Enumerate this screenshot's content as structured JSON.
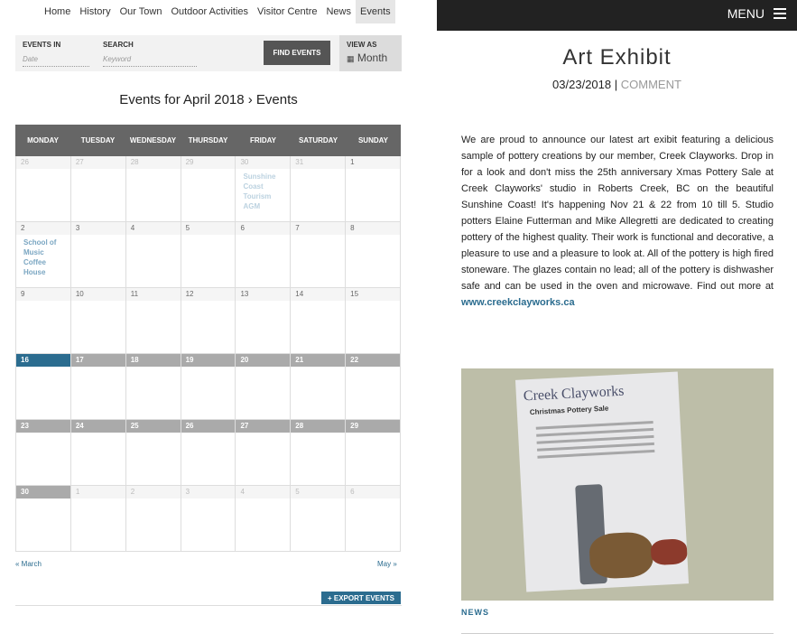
{
  "nav": {
    "items": [
      "Home",
      "History",
      "Our Town",
      "Outdoor Activities",
      "Visitor Centre",
      "News",
      "Events"
    ],
    "active": "Events"
  },
  "search_bar": {
    "events_in_label": "EVENTS IN",
    "date_placeholder": "Date",
    "search_label": "SEARCH",
    "keyword_placeholder": "Keyword",
    "find_button": "FIND EVENTS",
    "view_as_label": "VIEW AS",
    "view_value": "Month"
  },
  "calendar": {
    "title": "Events for April 2018 › Events",
    "days": [
      "MONDAY",
      "TUESDAY",
      "WEDNESDAY",
      "THURSDAY",
      "FRIDAY",
      "SATURDAY",
      "SUNDAY"
    ],
    "weeks": [
      [
        {
          "d": "26",
          "t": "other"
        },
        {
          "d": "27",
          "t": "other"
        },
        {
          "d": "28",
          "t": "other"
        },
        {
          "d": "29",
          "t": "other"
        },
        {
          "d": "30",
          "t": "other",
          "ev": "Sunshine Coast Tourism AGM"
        },
        {
          "d": "31",
          "t": "other"
        },
        {
          "d": "1",
          "t": "past"
        }
      ],
      [
        {
          "d": "2",
          "t": "past",
          "ev": "School of Music Coffee House"
        },
        {
          "d": "3",
          "t": "past"
        },
        {
          "d": "4",
          "t": "past"
        },
        {
          "d": "5",
          "t": "past"
        },
        {
          "d": "6",
          "t": "past"
        },
        {
          "d": "7",
          "t": "past"
        },
        {
          "d": "8",
          "t": "past"
        }
      ],
      [
        {
          "d": "9",
          "t": "past"
        },
        {
          "d": "10",
          "t": "past"
        },
        {
          "d": "11",
          "t": "past"
        },
        {
          "d": "12",
          "t": "past"
        },
        {
          "d": "13",
          "t": "past"
        },
        {
          "d": "14",
          "t": "past"
        },
        {
          "d": "15",
          "t": "past"
        }
      ],
      [
        {
          "d": "16",
          "t": "today"
        },
        {
          "d": "17",
          "t": "future"
        },
        {
          "d": "18",
          "t": "future"
        },
        {
          "d": "19",
          "t": "future"
        },
        {
          "d": "20",
          "t": "future"
        },
        {
          "d": "21",
          "t": "future"
        },
        {
          "d": "22",
          "t": "future"
        }
      ],
      [
        {
          "d": "23",
          "t": "future"
        },
        {
          "d": "24",
          "t": "future"
        },
        {
          "d": "25",
          "t": "future"
        },
        {
          "d": "26",
          "t": "future"
        },
        {
          "d": "27",
          "t": "future"
        },
        {
          "d": "28",
          "t": "future"
        },
        {
          "d": "29",
          "t": "future"
        }
      ],
      [
        {
          "d": "30",
          "t": "future"
        },
        {
          "d": "1",
          "t": "other"
        },
        {
          "d": "2",
          "t": "other"
        },
        {
          "d": "3",
          "t": "other"
        },
        {
          "d": "4",
          "t": "other"
        },
        {
          "d": "5",
          "t": "other"
        },
        {
          "d": "6",
          "t": "other"
        }
      ]
    ],
    "prev": "« March",
    "next": "May »",
    "export": "+ EXPORT EVENTS"
  },
  "header": {
    "menu_label": "MENU"
  },
  "article": {
    "title": "Art Exhibit",
    "date": "03/23/2018",
    "separator": "|",
    "comment": "COMMENT",
    "body": "We are proud to announce our latest art exibit featuring a delicious sample of pottery creations by our member, Creek Clayworks. Drop in for a look and don't miss the 25th anniversary Xmas Pottery Sale at Creek Clayworks' studio in Roberts Creek, BC on the beautiful Sunshine Coast! It's happening Nov 21 & 22 from 10 till 5. Studio potters Elaine Futterman and Mike Allegretti are dedicated to creating pottery of the highest quality. Their work is functional and decorative, a pleasure to use and a pleasure to look at. All of the pottery is high fired stoneware. The glazes contain no lead; all of the pottery is dishwasher safe and can be used in the oven and microwave. Find out more at ",
    "link": "www.creekclayworks.ca",
    "poster_title": "Creek Clayworks",
    "poster_sub": "Christmas Pottery Sale",
    "category": "NEWS"
  },
  "colors": {
    "accent": "#2b6c8f",
    "header_bg": "#222222",
    "calendar_head": "#666666"
  }
}
